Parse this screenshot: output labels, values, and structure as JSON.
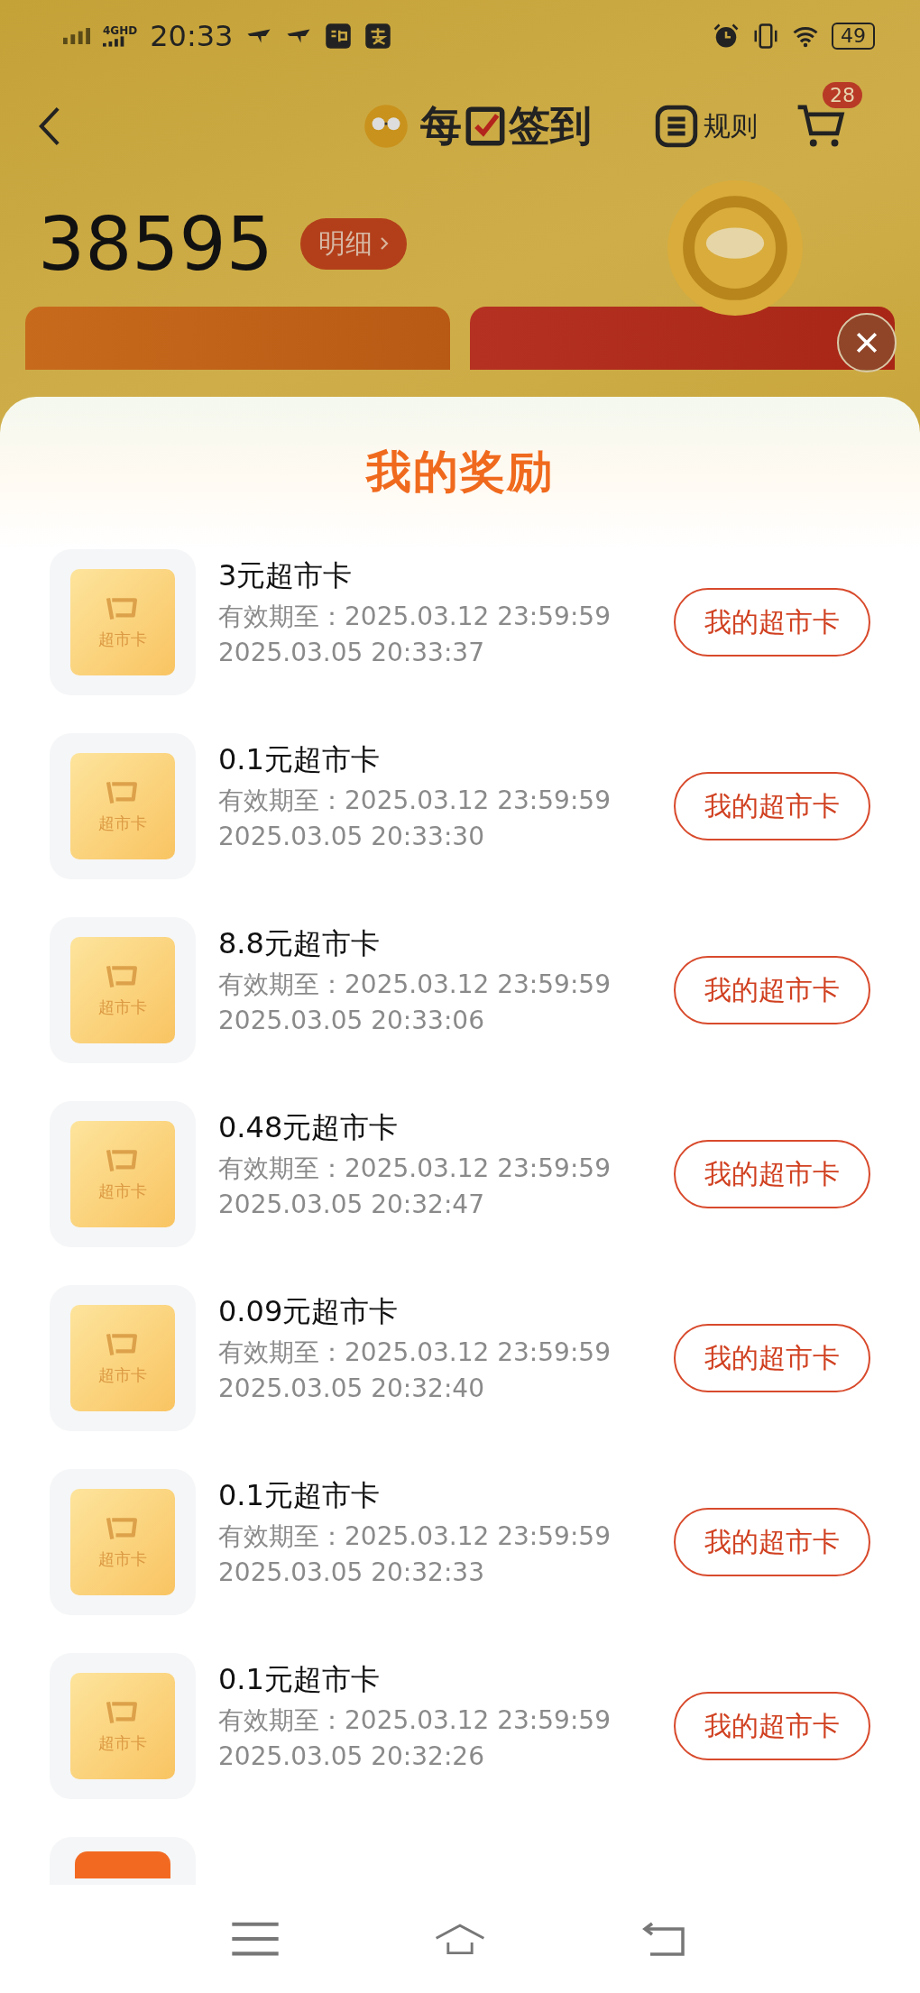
{
  "status_bar": {
    "network": "4GHD",
    "time": "20:33",
    "battery": "49"
  },
  "header": {
    "title_before": "每",
    "title_after": "签到",
    "rules": "规则",
    "cart_count": "28"
  },
  "points": {
    "value": "38595",
    "details": "明细"
  },
  "sheet": {
    "title": "我的奖励",
    "rewards": [
      {
        "name": "3元超市卡",
        "icon_label": "超市卡",
        "expiry": "有效期至：2025.03.12 23:59:59",
        "time": "2025.03.05 20:33:37",
        "button": "我的超市卡"
      },
      {
        "name": "0.1元超市卡",
        "icon_label": "超市卡",
        "expiry": "有效期至：2025.03.12 23:59:59",
        "time": "2025.03.05 20:33:30",
        "button": "我的超市卡"
      },
      {
        "name": "8.8元超市卡",
        "icon_label": "超市卡",
        "expiry": "有效期至：2025.03.12 23:59:59",
        "time": "2025.03.05 20:33:06",
        "button": "我的超市卡"
      },
      {
        "name": "0.48元超市卡",
        "icon_label": "超市卡",
        "expiry": "有效期至：2025.03.12 23:59:59",
        "time": "2025.03.05 20:32:47",
        "button": "我的超市卡"
      },
      {
        "name": "0.09元超市卡",
        "icon_label": "超市卡",
        "expiry": "有效期至：2025.03.12 23:59:59",
        "time": "2025.03.05 20:32:40",
        "button": "我的超市卡"
      },
      {
        "name": "0.1元超市卡",
        "icon_label": "超市卡",
        "expiry": "有效期至：2025.03.12 23:59:59",
        "time": "2025.03.05 20:32:33",
        "button": "我的超市卡"
      },
      {
        "name": "0.1元超市卡",
        "icon_label": "超市卡",
        "expiry": "有效期至：2025.03.12 23:59:59",
        "time": "2025.03.05 20:32:26",
        "button": "我的超市卡"
      }
    ]
  }
}
